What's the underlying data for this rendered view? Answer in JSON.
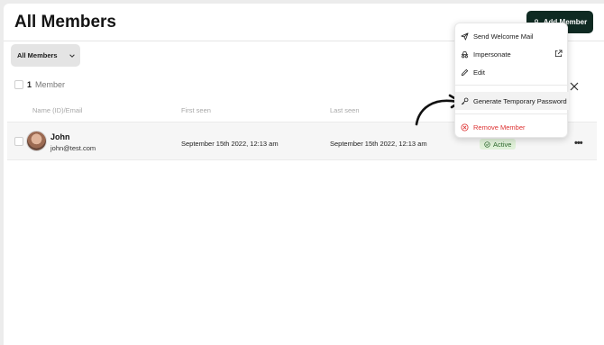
{
  "header": {
    "title": "All Members",
    "add_button": "Add Member"
  },
  "filter": {
    "label": "All Members"
  },
  "summary": {
    "count": "1",
    "unit": "Member"
  },
  "table": {
    "columns": [
      "Name (ID)/Email",
      "First seen",
      "Last seen"
    ],
    "rows": [
      {
        "name": "John",
        "email": "john@test.com",
        "first_seen": "September 15th 2022, 12:13 am",
        "last_seen": "September 15th 2022, 12:13 am",
        "status": "Active"
      }
    ]
  },
  "menu": {
    "items": [
      {
        "label": "Send Welcome Mail",
        "icon": "send-icon"
      },
      {
        "label": "Impersonate",
        "icon": "incognito-icon"
      },
      {
        "label": "Edit",
        "icon": "pencil-icon"
      },
      {
        "label": "Generate Temporary Password",
        "icon": "key-icon"
      },
      {
        "label": "Remove Member",
        "icon": "remove-circle-icon"
      }
    ]
  },
  "colors": {
    "brand": "#0f2a22",
    "danger": "#dd3333",
    "active": "#2f6a2f"
  }
}
